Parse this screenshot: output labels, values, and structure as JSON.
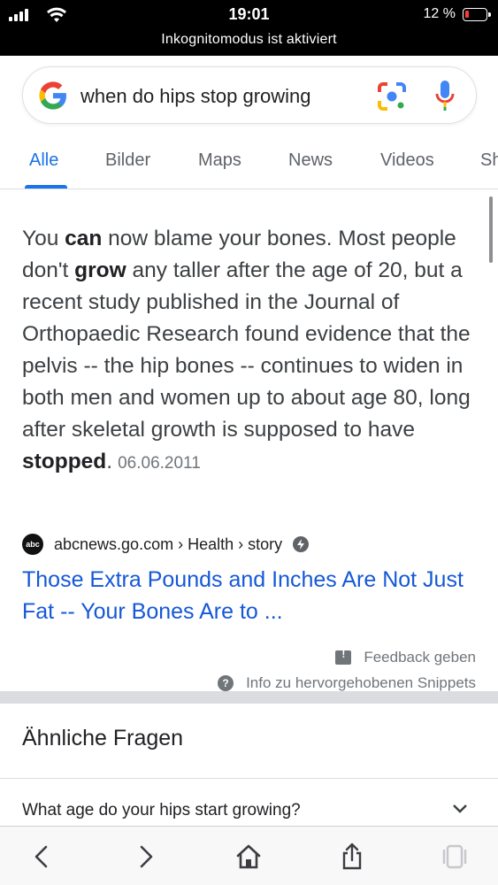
{
  "status_bar": {
    "time": "19:01",
    "battery_text": "12 %",
    "battery_level_percent": 12,
    "battery_color": "#ff3b30",
    "incognito_text": "Inkognitomodus ist aktiviert"
  },
  "search": {
    "query": "when do hips stop growing",
    "logo_icon": "google-g-icon",
    "lens_icon": "google-lens-icon",
    "mic_icon": "microphone-icon"
  },
  "tabs": [
    {
      "label": "Alle",
      "active": true
    },
    {
      "label": "Bilder"
    },
    {
      "label": "Maps"
    },
    {
      "label": "News"
    },
    {
      "label": "Videos"
    },
    {
      "label": "Sh"
    }
  ],
  "snippet": {
    "p1": "You ",
    "b1": "can",
    "p2": " now blame your bones. Most people don't ",
    "b2": "grow",
    "p3": " any taller after the age of 20, but a recent study published in the Journal of Orthopaedic Research found evidence that the pelvis -- the hip bones -- continues to widen in both men and women up to about age 80, long after skeletal growth is supposed to have ",
    "b3": "stopped",
    "p4": ".",
    "date": "06.06.2011"
  },
  "source": {
    "logo_text": "abc",
    "breadcrumb": "abcnews.go.com › Health › story",
    "amp_icon": "lightning-bolt-icon"
  },
  "result": {
    "title": "Those Extra Pounds and Inches Are Not Just Fat -- Your Bones Are to ..."
  },
  "feedback": {
    "label": "Feedback geben",
    "info_label": "Info zu hervorgehobenen Snippets"
  },
  "related": {
    "heading": "Ähnliche Fragen",
    "questions": [
      "What age do your hips start growing?"
    ]
  },
  "toolbar": {
    "icons": [
      "back-icon",
      "forward-icon",
      "home-icon",
      "share-icon",
      "tabs-icon"
    ]
  },
  "colors": {
    "accent": "#1a73e8",
    "link": "#1558d6"
  }
}
